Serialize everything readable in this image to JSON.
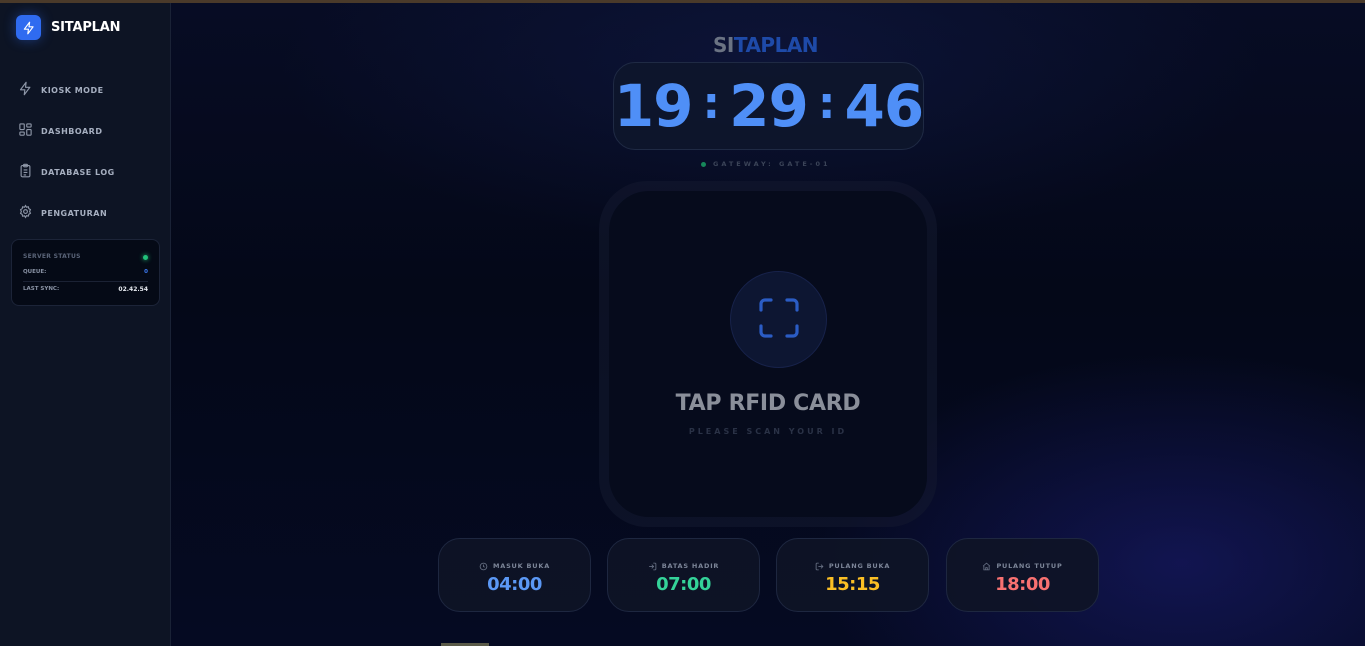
{
  "sidebar": {
    "brand": "SITAPLAN",
    "nav": [
      {
        "label": "KIOSK MODE",
        "icon": "bolt-icon"
      },
      {
        "label": "DASHBOARD",
        "icon": "grid-icon"
      },
      {
        "label": "DATABASE LOG",
        "icon": "clipboard-icon"
      },
      {
        "label": "PENGATURAN",
        "icon": "gear-icon"
      }
    ],
    "server_status": {
      "title": "SERVER STATUS",
      "queue_label": "QUEUE:",
      "queue_value": "0",
      "last_sync_label": "LAST SYNC:",
      "last_sync_value": "02.42.54",
      "status_color": "#21c17a"
    }
  },
  "main": {
    "title_si": "SI",
    "title_rest": "TAPLAN",
    "clock": {
      "hours": "19",
      "minutes": "29",
      "seconds": "46"
    },
    "gateway": "GATEWAY: GATE-01",
    "scan": {
      "title": "TAP RFID CARD",
      "subtitle": "PLEASE SCAN YOUR ID",
      "icon": "scan-frame-icon"
    },
    "schedule": [
      {
        "label": "MASUK BUKA",
        "time": "04:00",
        "icon": "clock-icon",
        "color": "#5b98f5"
      },
      {
        "label": "BATAS HADIR",
        "time": "07:00",
        "icon": "login-icon",
        "color": "#34d399"
      },
      {
        "label": "PULANG BUKA",
        "time": "15:15",
        "icon": "logout-icon",
        "color": "#fbbf24"
      },
      {
        "label": "PULANG TUTUP",
        "time": "18:00",
        "icon": "home-icon",
        "color": "#f87171"
      }
    ]
  }
}
